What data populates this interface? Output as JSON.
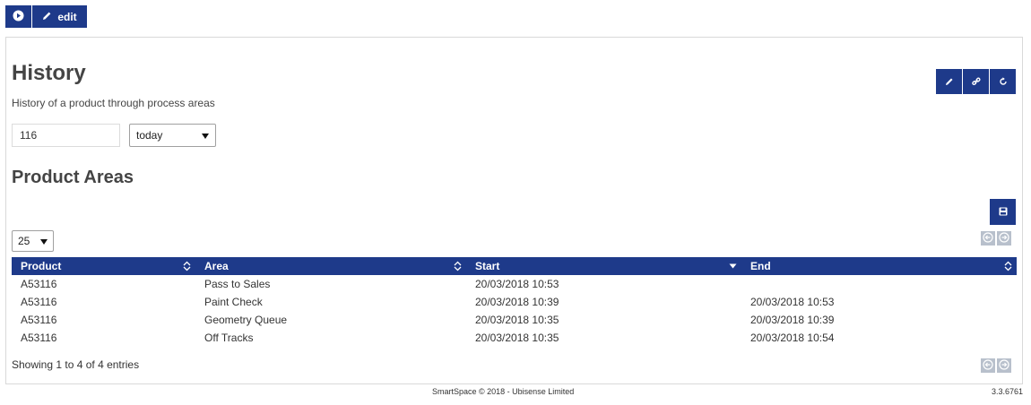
{
  "toolbar": {
    "play_icon": "play-circle-icon",
    "edit_label": "edit",
    "edit_icon": "pencil-icon"
  },
  "page": {
    "title": "History",
    "description": "History of a product through process areas",
    "tools": [
      "pencil-icon",
      "link-icon",
      "refresh-icon"
    ]
  },
  "filters": {
    "product_value": "116",
    "range_selected": "today"
  },
  "section": {
    "title": "Product Areas",
    "save_icon": "save-icon"
  },
  "table": {
    "page_length": "25",
    "columns": [
      {
        "label": "Product",
        "sort": "both"
      },
      {
        "label": "Area",
        "sort": "both"
      },
      {
        "label": "Start",
        "sort": "desc"
      },
      {
        "label": "End",
        "sort": "both"
      }
    ],
    "rows": [
      [
        "A53116",
        "Pass to Sales",
        "20/03/2018 10:53",
        ""
      ],
      [
        "A53116",
        "Paint Check",
        "20/03/2018 10:39",
        "20/03/2018 10:53"
      ],
      [
        "A53116",
        "Geometry Queue",
        "20/03/2018 10:35",
        "20/03/2018 10:39"
      ],
      [
        "A53116",
        "Off Tracks",
        "20/03/2018 10:35",
        "20/03/2018 10:54"
      ]
    ],
    "info": "Showing 1 to 4 of 4 entries"
  },
  "footer": {
    "copyright": "SmartSpace © 2018 - Ubisense Limited",
    "version": "3.3.6761"
  },
  "colors": {
    "accent": "#1e3a8a",
    "pager_disabled": "#b8c0cc"
  }
}
